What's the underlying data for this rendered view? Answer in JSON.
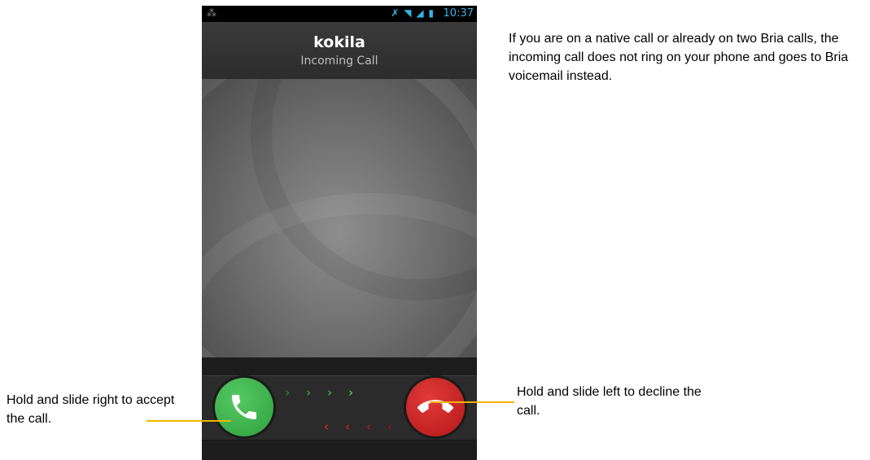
{
  "status_bar": {
    "time": "10:37",
    "notification_icon": "notification-icon",
    "icons": [
      "no-sim-icon",
      "wifi-icon",
      "signal-icon",
      "battery-icon"
    ]
  },
  "call": {
    "caller_name": "kokila",
    "status": "Incoming Call"
  },
  "actions": {
    "accept_icon": "phone-icon",
    "decline_icon": "hang-up-icon",
    "accept_color": "#3cb64a",
    "decline_color": "#c8201f",
    "accept_chevron_color": "#3fae3f",
    "decline_chevron_color": "#c81e1e"
  },
  "annotations": {
    "top_note": "If you are on a native call or already on two Bria calls, the incoming call does not ring on your phone and goes to Bria voicemail instead.",
    "accept_note": "Hold and slide right to accept the call.",
    "decline_note": "Hold and slide left to decline the call.",
    "leader_color": "#f0b400"
  }
}
